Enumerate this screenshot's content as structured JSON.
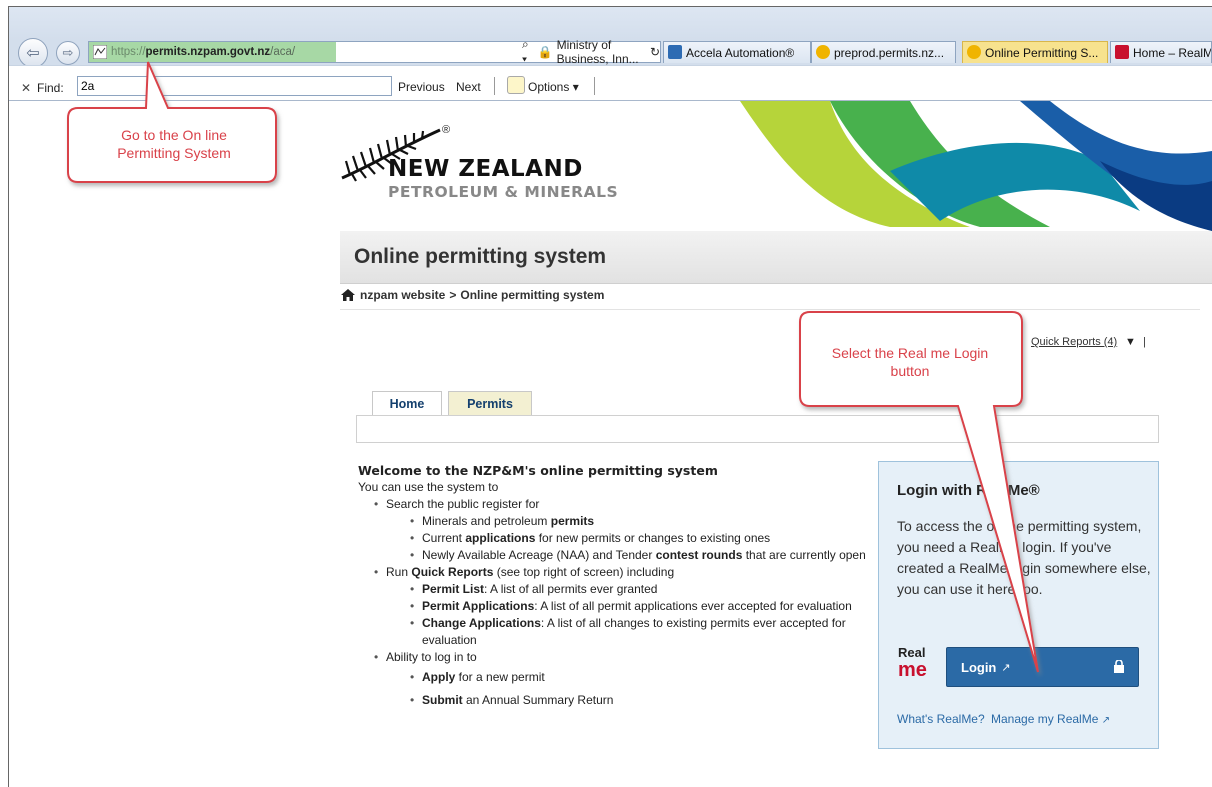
{
  "browser": {
    "url_scheme": "https://",
    "url_host": "permits.nzpam.govt.nz",
    "url_path": "/aca/",
    "search_icon_label": "⌕ ▾",
    "site_identity": "Ministry of Business, Inn...",
    "tabs": [
      {
        "label": "Accela Automation®",
        "icon_color": "#2d6bb3"
      },
      {
        "label": "preprod.permits.nz...",
        "icon_color": "#f0b400"
      },
      {
        "label": "Online Permitting S...",
        "icon_color": "#f0b400"
      },
      {
        "label": "Home – RealMe",
        "icon_color": "#c8102e"
      }
    ],
    "find": {
      "close": "✕",
      "label": "Find:",
      "value": "2a",
      "previous": "Previous",
      "next": "Next",
      "options": "Options ▾"
    }
  },
  "brand": {
    "line1": "NEW ZEALAND",
    "line2": "PETROLEUM & MINERALS",
    "registered": "®"
  },
  "page": {
    "title": "Online permitting system",
    "breadcrumb_home": "nzpam website",
    "breadcrumb_sep": ">",
    "breadcrumb_current": "Online permitting system",
    "quick_reports": "Quick Reports (4)",
    "quick_reports_caret": "▼",
    "quick_reports_bar": "|",
    "tabs": [
      "Home",
      "Permits"
    ]
  },
  "welcome": {
    "heading": "Welcome to the NZP&M's online permitting system",
    "intro": "You can use the system to",
    "item1": "Search the public register for",
    "item1_sub1_a": "Minerals and petroleum ",
    "item1_sub1_b": "permits",
    "item1_sub2_a": "Current ",
    "item1_sub2_b": "applications",
    "item1_sub2_c": " for new permits or changes to existing ones",
    "item1_sub3_a": "Newly Available Acreage (NAA) and Tender ",
    "item1_sub3_b": "contest rounds",
    "item1_sub3_c": " that are currently open",
    "item2_a": "Run ",
    "item2_b": "Quick Reports",
    "item2_c": " (see top right of screen) including",
    "item2_sub1_a": "Permit List",
    "item2_sub1_b": ": A list of all permits ever granted",
    "item2_sub2_a": "Permit Applications",
    "item2_sub2_b": ": A list of all permit applications ever accepted for evaluation",
    "item2_sub3_a": "Change Applications",
    "item2_sub3_b": ": A list of all changes to existing permits ever accepted for evaluation",
    "item3": "Ability to log in to",
    "item3_sub1_a": "Apply",
    "item3_sub1_b": " for a new permit",
    "item3_sub2_a": "Submit",
    "item3_sub2_b": " an Annual Summary Return"
  },
  "login": {
    "title": "Login with RealMe®",
    "text": "To access the online permitting system, you need a RealMe login. If you've created a RealMe login somewhere else, you can use it here too.",
    "logo_real": "Real",
    "logo_me": "me",
    "button": "Login",
    "link1": "What's RealMe?",
    "link2": "Manage my RealMe"
  },
  "callouts": {
    "left": "Go to the On line Permitting System",
    "right": "Select the Real me Login button"
  },
  "colors": {
    "callout": "#d9424a",
    "login_button": "#2b6aa6",
    "login_panel": "#e6f0f8"
  }
}
